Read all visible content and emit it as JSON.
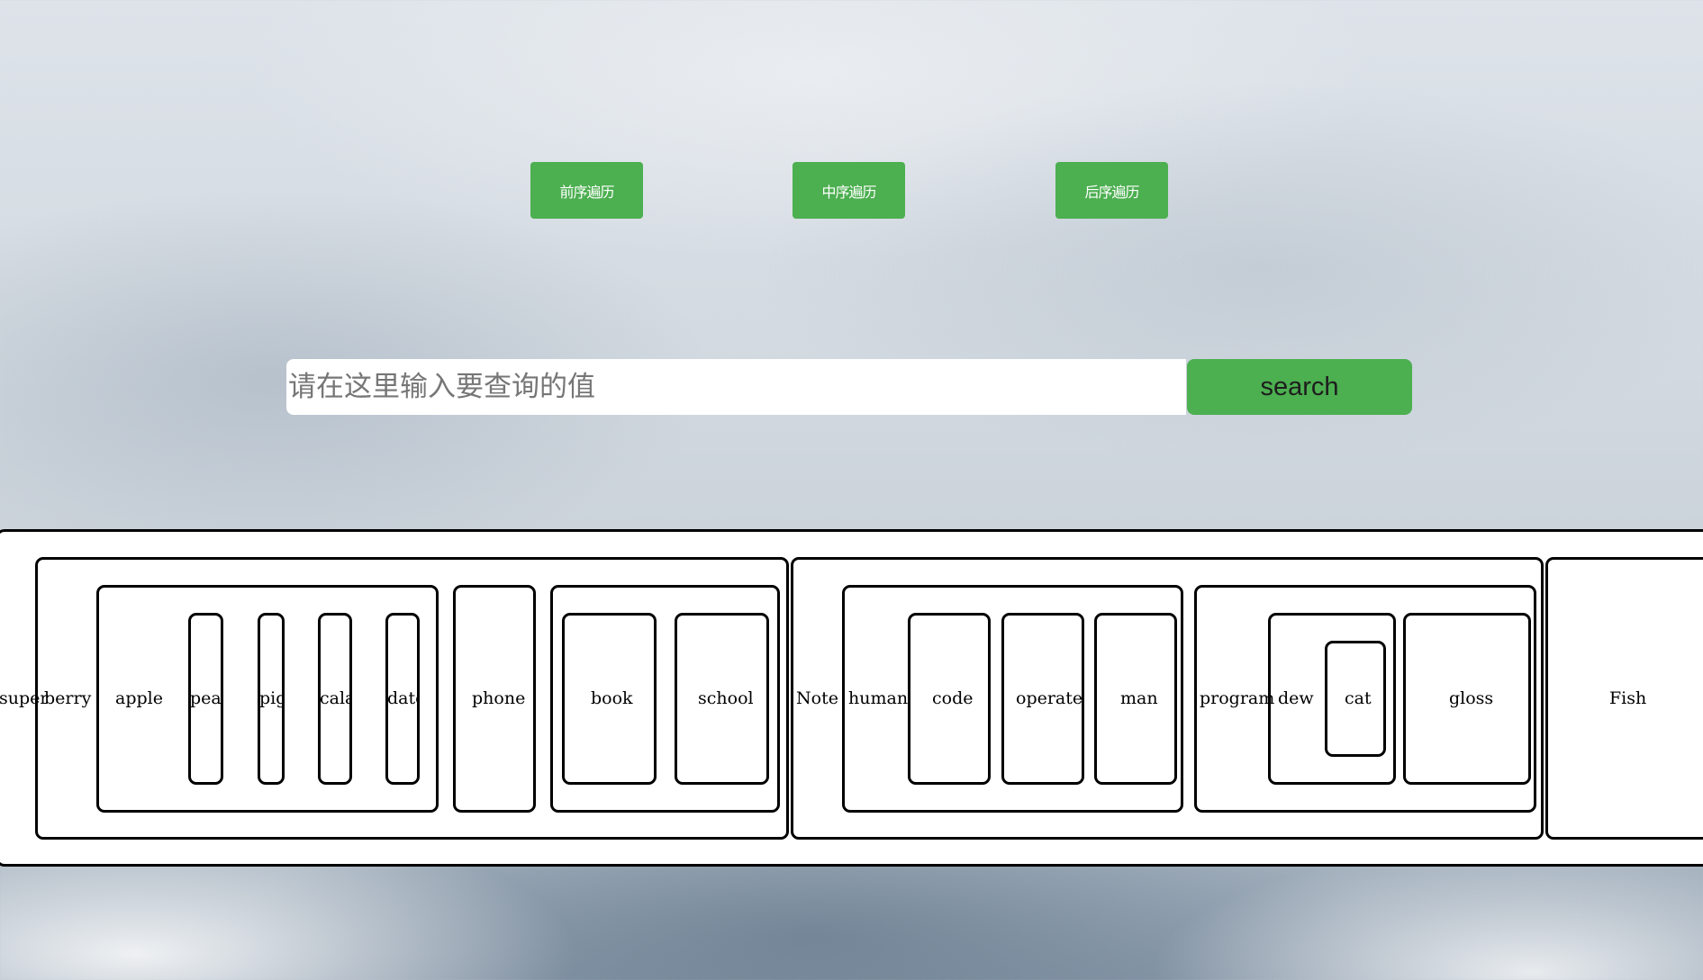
{
  "traversal_buttons": {
    "preorder": "前序遍历",
    "inorder": "中序遍历",
    "postorder": "后序遍历"
  },
  "search": {
    "placeholder": "请在这里输入要查询的值",
    "value": "",
    "button_label": "search"
  },
  "tree": {
    "labels": {
      "super": "super",
      "berry": "berry",
      "apple": "apple",
      "pear": "pear",
      "pig": "pig",
      "cala": "cala",
      "date": "date",
      "phone": "phone",
      "book": "book",
      "school": "school",
      "note": "Note",
      "human": "human",
      "code": "code",
      "operate": "operate",
      "man": "man",
      "program": "program",
      "dew": "dew",
      "cat": "cat",
      "gloss": "gloss",
      "fish": "Fish"
    }
  }
}
